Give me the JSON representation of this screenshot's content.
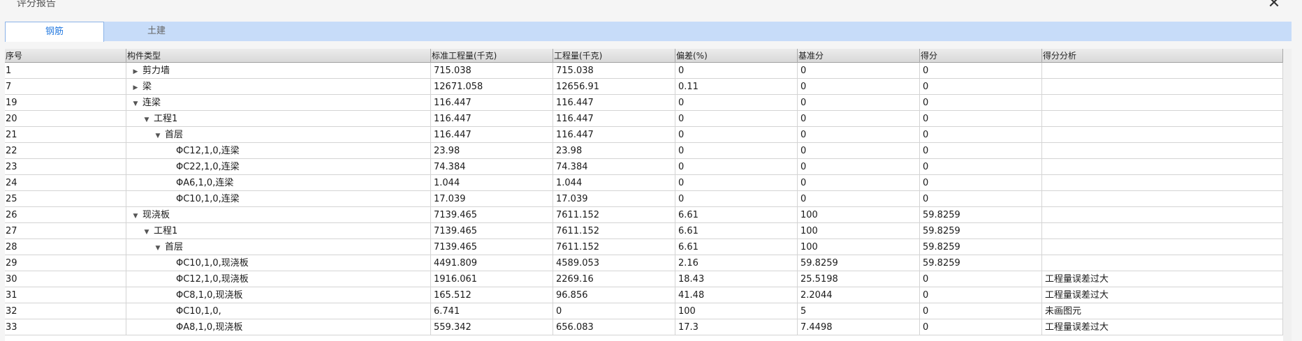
{
  "window": {
    "title": "评分报告",
    "close_glyph": "✕"
  },
  "tabs": [
    {
      "label": "钢筋",
      "active": true
    },
    {
      "label": "土建",
      "active": false
    }
  ],
  "columns": [
    "序号",
    "构件类型",
    "标准工程量(千克)",
    "工程量(千克)",
    "偏差(%)",
    "基准分",
    "得分",
    "得分分析"
  ],
  "rows": [
    {
      "id": "1",
      "level": 0,
      "toggle": "collapsed",
      "name": "剪力墙",
      "std": "715.038",
      "qty": "715.038",
      "dev": "0",
      "base": "0",
      "score": "0",
      "analysis": ""
    },
    {
      "id": "7",
      "level": 0,
      "toggle": "collapsed",
      "name": "梁",
      "std": "12671.058",
      "qty": "12656.91",
      "dev": "0.11",
      "base": "0",
      "score": "0",
      "analysis": ""
    },
    {
      "id": "19",
      "level": 0,
      "toggle": "expanded",
      "name": "连梁",
      "std": "116.447",
      "qty": "116.447",
      "dev": "0",
      "base": "0",
      "score": "0",
      "analysis": ""
    },
    {
      "id": "20",
      "level": 1,
      "toggle": "expanded",
      "name": "工程1",
      "std": "116.447",
      "qty": "116.447",
      "dev": "0",
      "base": "0",
      "score": "0",
      "analysis": ""
    },
    {
      "id": "21",
      "level": 2,
      "toggle": "expanded",
      "name": "首层",
      "std": "116.447",
      "qty": "116.447",
      "dev": "0",
      "base": "0",
      "score": "0",
      "analysis": ""
    },
    {
      "id": "22",
      "level": 3,
      "toggle": "none",
      "name": "ΦC12,1,0,连梁",
      "std": "23.98",
      "qty": "23.98",
      "dev": "0",
      "base": "0",
      "score": "0",
      "analysis": ""
    },
    {
      "id": "23",
      "level": 3,
      "toggle": "none",
      "name": "ΦC22,1,0,连梁",
      "std": "74.384",
      "qty": "74.384",
      "dev": "0",
      "base": "0",
      "score": "0",
      "analysis": ""
    },
    {
      "id": "24",
      "level": 3,
      "toggle": "none",
      "name": "ΦA6,1,0,连梁",
      "std": "1.044",
      "qty": "1.044",
      "dev": "0",
      "base": "0",
      "score": "0",
      "analysis": ""
    },
    {
      "id": "25",
      "level": 3,
      "toggle": "none",
      "name": "ΦC10,1,0,连梁",
      "std": "17.039",
      "qty": "17.039",
      "dev": "0",
      "base": "0",
      "score": "0",
      "analysis": ""
    },
    {
      "id": "26",
      "level": 0,
      "toggle": "expanded",
      "name": "现浇板",
      "std": "7139.465",
      "qty": "7611.152",
      "dev": "6.61",
      "base": "100",
      "score": "59.8259",
      "analysis": ""
    },
    {
      "id": "27",
      "level": 1,
      "toggle": "expanded",
      "name": "工程1",
      "std": "7139.465",
      "qty": "7611.152",
      "dev": "6.61",
      "base": "100",
      "score": "59.8259",
      "analysis": ""
    },
    {
      "id": "28",
      "level": 2,
      "toggle": "expanded",
      "name": "首层",
      "std": "7139.465",
      "qty": "7611.152",
      "dev": "6.61",
      "base": "100",
      "score": "59.8259",
      "analysis": ""
    },
    {
      "id": "29",
      "level": 3,
      "toggle": "none",
      "name": "ΦC10,1,0,现浇板",
      "std": "4491.809",
      "qty": "4589.053",
      "dev": "2.16",
      "base": "59.8259",
      "score": "59.8259",
      "analysis": ""
    },
    {
      "id": "30",
      "level": 3,
      "toggle": "none",
      "name": "ΦC12,1,0,现浇板",
      "std": "1916.061",
      "qty": "2269.16",
      "dev": "18.43",
      "base": "25.5198",
      "score": "0",
      "analysis": "工程量误差过大"
    },
    {
      "id": "31",
      "level": 3,
      "toggle": "none",
      "name": "ΦC8,1,0,现浇板",
      "std": "165.512",
      "qty": "96.856",
      "dev": "41.48",
      "base": "2.2044",
      "score": "0",
      "analysis": "工程量误差过大"
    },
    {
      "id": "32",
      "level": 3,
      "toggle": "none",
      "name": "ΦC10,1,0,",
      "std": "6.741",
      "qty": "0",
      "dev": "100",
      "base": "5",
      "score": "0",
      "analysis": "未画图元"
    },
    {
      "id": "33",
      "level": 3,
      "toggle": "none",
      "name": "ΦA8,1,0,现浇板",
      "std": "559.342",
      "qty": "656.083",
      "dev": "17.3",
      "base": "7.4498",
      "score": "0",
      "analysis": "工程量误差过大"
    }
  ],
  "icons": {
    "collapsed": "▶",
    "expanded": "▼"
  }
}
